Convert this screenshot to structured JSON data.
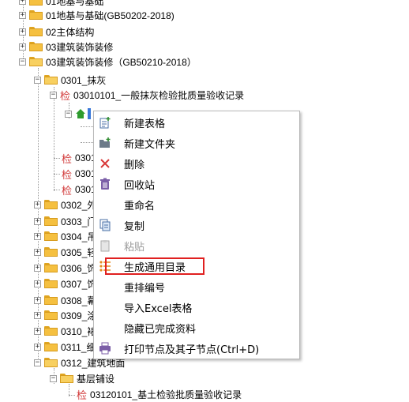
{
  "tree": {
    "items": [
      {
        "label": "01地基与基础"
      },
      {
        "label": "01地基与基础(GB50202-2018)"
      },
      {
        "label": "02主体结构"
      },
      {
        "label": "03建筑装饰装修"
      },
      {
        "label": "03建筑装饰装修（GB50210-2018）"
      },
      {
        "label": "0301_抹灰"
      },
      {
        "label": "03010101_一般抹灰检验批质量验收记录",
        "badge": "检"
      },
      {
        "label": "0301",
        "badge": "检"
      },
      {
        "label": "0301",
        "badge": "检"
      },
      {
        "label": "0301",
        "badge": "检"
      },
      {
        "label": "0302_外"
      },
      {
        "label": "0303_门"
      },
      {
        "label": "0304_吊"
      },
      {
        "label": "0305_轻"
      },
      {
        "label": "0306_饰"
      },
      {
        "label": "0307_饰"
      },
      {
        "label": "0308_幕"
      },
      {
        "label": "0309_涂"
      },
      {
        "label": "0310_裱"
      },
      {
        "label": "0311_细"
      },
      {
        "label": "0312_建筑地面"
      },
      {
        "label": "基层铺设"
      },
      {
        "label": "03120101_基土检验批质量验收记录",
        "badge": "检"
      }
    ]
  },
  "context_menu": {
    "items": [
      {
        "label": "新建表格",
        "icon": "new-table-icon",
        "enabled": true
      },
      {
        "label": "新建文件夹",
        "icon": "new-folder-icon",
        "enabled": true
      },
      {
        "label": "删除",
        "icon": "delete-x-icon",
        "enabled": true
      },
      {
        "label": "回收站",
        "icon": "trash-icon",
        "enabled": true
      },
      {
        "label": "重命名",
        "icon": "",
        "enabled": true
      },
      {
        "label": "复制",
        "icon": "copy-icon",
        "enabled": true
      },
      {
        "label": "粘贴",
        "icon": "paste-icon",
        "enabled": false
      },
      {
        "label": "生成通用目录",
        "icon": "list-icon",
        "enabled": true,
        "highlighted": true
      },
      {
        "label": "重排编号",
        "icon": "",
        "enabled": true
      },
      {
        "label": "导入Excel表格",
        "icon": "",
        "enabled": true
      },
      {
        "label": "隐藏已完成资料",
        "icon": "",
        "enabled": true
      },
      {
        "label": "打印节点及其子节点(Ctrl+D)",
        "icon": "print-icon",
        "enabled": true
      }
    ]
  },
  "colors": {
    "highlight_border": "#e02020",
    "folder": "#f5c040",
    "badge": "#d23a3a"
  }
}
